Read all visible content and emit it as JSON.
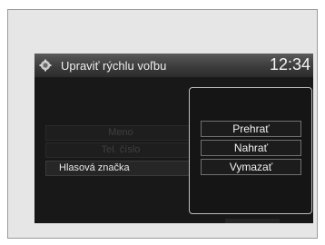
{
  "header": {
    "title": "Upraviť rýchlu voľbu",
    "time": "12:34"
  },
  "list": {
    "items": [
      {
        "label": "Meno",
        "enabled": false
      },
      {
        "label": "Tel. číslo",
        "enabled": false
      },
      {
        "label": "Hlasová značka",
        "enabled": true
      }
    ]
  },
  "popup_menu": {
    "items": [
      {
        "label": "Prehrať"
      },
      {
        "label": "Nahrať"
      },
      {
        "label": "Vymazať"
      }
    ]
  },
  "icons": {
    "header": "settings-knob-icon"
  }
}
